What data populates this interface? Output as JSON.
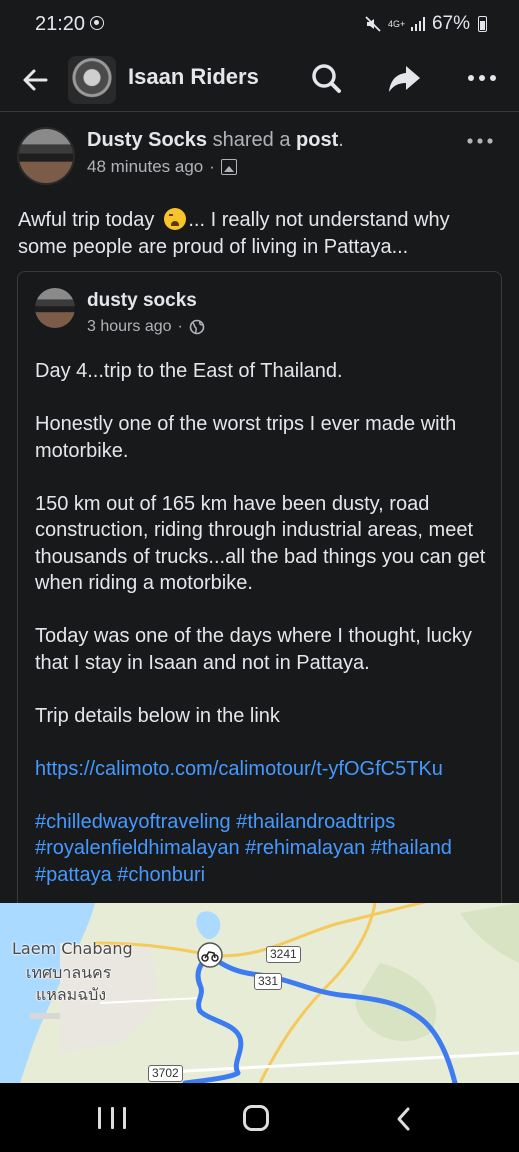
{
  "status_bar": {
    "time": "21:20",
    "network": "4G+",
    "battery": "67%"
  },
  "header": {
    "title": "Isaan Riders"
  },
  "post": {
    "author": "Dusty Socks",
    "action_text": " shared a ",
    "action_object": "post",
    "action_end": ".",
    "time": "48 minutes ago",
    "text_before_emoji": "Awful trip today",
    "text_after_emoji": "... I really not understand why some people are proud of living in Pattaya..."
  },
  "shared_post": {
    "author": "dusty socks",
    "time": "3 hours ago",
    "paragraphs": [
      "Day 4...trip to the East of Thailand.",
      "Honestly one of the worst trips I ever made with motorbike.",
      "150 km out of 165 km have been dusty, road construction, riding through industrial areas, meet thousands of trucks...all the bad things you can get when riding a motorbike.",
      "Today was one of the days where I thought, lucky that I stay in Isaan and not in Pattaya.",
      "Trip details below in the link"
    ],
    "link": "https://calimoto.com/calimotour/t-yfOGfC5TKu",
    "hashtags": "#chilledwayoftraveling #thailandroadtrips #royalenfieldhimalayan #rehimalayan #thailand #pattaya #chonburi"
  },
  "map": {
    "place_en": "Laem Chabang",
    "place_th_1": "เทศบาลนคร",
    "place_th_2": "แหลมฉบัง",
    "road_a": "3241",
    "road_b": "331",
    "road_c": "3702",
    "route_color": "#3d7bf2"
  }
}
